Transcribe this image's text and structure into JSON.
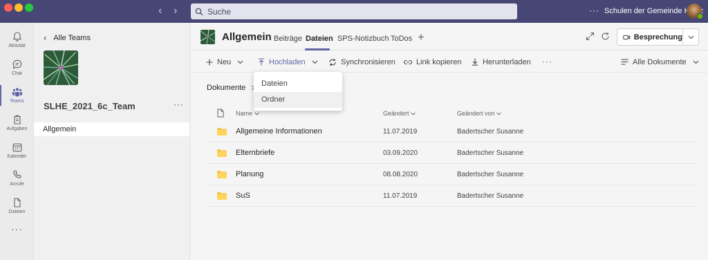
{
  "titlebar": {
    "search_placeholder": "Suche",
    "org_name": "Schulen der Gemeinde Köniz",
    "more": "···",
    "back_arrow": "‹",
    "forward_arrow": "›"
  },
  "rail": {
    "items": [
      {
        "label": "Aktivität",
        "icon": "bell-icon"
      },
      {
        "label": "Chat",
        "icon": "chat-icon"
      },
      {
        "label": "Teams",
        "icon": "teams-icon",
        "active": true
      },
      {
        "label": "Aufgaben",
        "icon": "assignments-icon"
      },
      {
        "label": "Kalender",
        "icon": "calendar-icon"
      },
      {
        "label": "Anrufe",
        "icon": "phone-icon"
      },
      {
        "label": "Dateien",
        "icon": "file-icon"
      }
    ],
    "more": "···"
  },
  "teampanel": {
    "back_label": "Alle Teams",
    "back_chevron": "‹",
    "team_name": "SLHE_2021_6c_Team",
    "more": "···",
    "channels": [
      "Allgemein"
    ]
  },
  "header": {
    "channel_title": "Allgemein",
    "tabs": [
      "Beiträge",
      "Dateien",
      "SPS-Notizbuch",
      "ToDos"
    ],
    "active_tab": "Dateien",
    "add_tab": "+",
    "meeting_label": "Besprechung"
  },
  "toolbar": {
    "new_label": "Neu",
    "upload_label": "Hochladen",
    "sync_label": "Synchronisieren",
    "copy_link_label": "Link kopieren",
    "download_label": "Herunterladen",
    "more": "···",
    "view_label": "Alle Dokumente"
  },
  "breadcrumb": {
    "root": "Dokumente",
    "separator": ">"
  },
  "table": {
    "columns": [
      "Name",
      "Geändert",
      "Geändert von"
    ],
    "rows": [
      {
        "name": "Allgemeine Informationen",
        "modified": "11.07.2019",
        "modified_by": "Badertscher Susanne"
      },
      {
        "name": "Elternbriefe",
        "modified": "03.09.2020",
        "modified_by": "Badertscher Susanne"
      },
      {
        "name": "Planung",
        "modified": "08.08.2020",
        "modified_by": "Badertscher Susanne"
      },
      {
        "name": "SuS",
        "modified": "11.07.2019",
        "modified_by": "Badertscher Susanne"
      }
    ]
  },
  "upload_menu": {
    "items": [
      "Dateien",
      "Ordner"
    ],
    "hovered": "Ordner"
  },
  "colors": {
    "titlebar": "#464775",
    "accent": "#6264a7",
    "folder": "#f5c24a"
  }
}
